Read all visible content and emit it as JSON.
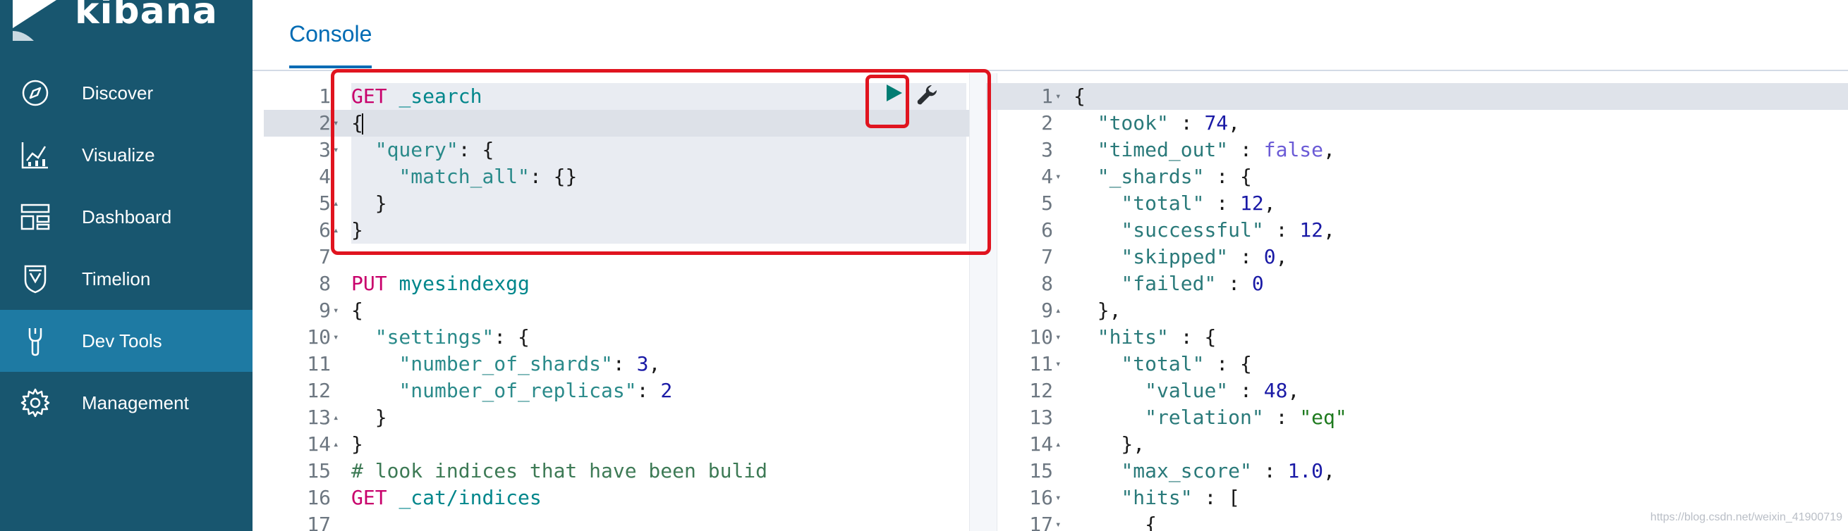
{
  "app": {
    "name": "kibana"
  },
  "sidebar": {
    "items": [
      {
        "label": "Discover",
        "icon": "compass-icon",
        "active": false
      },
      {
        "label": "Visualize",
        "icon": "chart-icon",
        "active": false
      },
      {
        "label": "Dashboard",
        "icon": "dashboard-icon",
        "active": false
      },
      {
        "label": "Timelion",
        "icon": "shield-icon",
        "active": false
      },
      {
        "label": "Dev Tools",
        "icon": "wrench-icon",
        "active": true
      },
      {
        "label": "Management",
        "icon": "gear-icon",
        "active": false
      }
    ]
  },
  "tabs": [
    {
      "label": "Console",
      "active": true
    }
  ],
  "request_editor": {
    "lines": [
      {
        "n": "1",
        "fold": "",
        "tokens": [
          [
            "kw",
            "GET"
          ],
          [
            "pun",
            " "
          ],
          [
            "url",
            "_search"
          ]
        ]
      },
      {
        "n": "2",
        "fold": "▾",
        "tokens": [
          [
            "pun",
            "{"
          ]
        ]
      },
      {
        "n": "3",
        "fold": "▾",
        "tokens": [
          [
            "pun",
            "  "
          ],
          [
            "key",
            "\"query\""
          ],
          [
            "pun",
            ": {"
          ]
        ]
      },
      {
        "n": "4",
        "fold": "",
        "tokens": [
          [
            "pun",
            "    "
          ],
          [
            "key",
            "\"match_all\""
          ],
          [
            "pun",
            ": {}"
          ]
        ]
      },
      {
        "n": "5",
        "fold": "▴",
        "tokens": [
          [
            "pun",
            "  }"
          ]
        ]
      },
      {
        "n": "6",
        "fold": "▴",
        "tokens": [
          [
            "pun",
            "}"
          ]
        ]
      },
      {
        "n": "7",
        "fold": "",
        "tokens": []
      },
      {
        "n": "8",
        "fold": "",
        "tokens": [
          [
            "kw",
            "PUT"
          ],
          [
            "pun",
            " "
          ],
          [
            "url",
            "myesindexgg"
          ]
        ]
      },
      {
        "n": "9",
        "fold": "▾",
        "tokens": [
          [
            "pun",
            "{"
          ]
        ]
      },
      {
        "n": "10",
        "fold": "▾",
        "tokens": [
          [
            "pun",
            "  "
          ],
          [
            "key",
            "\"settings\""
          ],
          [
            "pun",
            ": {"
          ]
        ]
      },
      {
        "n": "11",
        "fold": "",
        "tokens": [
          [
            "pun",
            "    "
          ],
          [
            "key",
            "\"number_of_shards\""
          ],
          [
            "pun",
            ": "
          ],
          [
            "num",
            "3"
          ],
          [
            "pun",
            ","
          ]
        ]
      },
      {
        "n": "12",
        "fold": "",
        "tokens": [
          [
            "pun",
            "    "
          ],
          [
            "key",
            "\"number_of_replicas\""
          ],
          [
            "pun",
            ": "
          ],
          [
            "num",
            "2"
          ]
        ]
      },
      {
        "n": "13",
        "fold": "▴",
        "tokens": [
          [
            "pun",
            "  }"
          ]
        ]
      },
      {
        "n": "14",
        "fold": "▴",
        "tokens": [
          [
            "pun",
            "}"
          ]
        ]
      },
      {
        "n": "15",
        "fold": "",
        "tokens": [
          [
            "cmt",
            "# look indices that have been bulid"
          ]
        ]
      },
      {
        "n": "16",
        "fold": "",
        "tokens": [
          [
            "kw",
            "GET"
          ],
          [
            "pun",
            " "
          ],
          [
            "url",
            "_cat/indices"
          ]
        ]
      },
      {
        "n": "17",
        "fold": "",
        "tokens": []
      }
    ]
  },
  "response_editor": {
    "lines": [
      {
        "n": "1",
        "fold": "▾",
        "tokens": [
          [
            "pun",
            "{"
          ]
        ]
      },
      {
        "n": "2",
        "fold": "",
        "tokens": [
          [
            "pun",
            "  "
          ],
          [
            "rkey",
            "\"took\""
          ],
          [
            "pun",
            " : "
          ],
          [
            "num",
            "74"
          ],
          [
            "pun",
            ","
          ]
        ]
      },
      {
        "n": "3",
        "fold": "",
        "tokens": [
          [
            "pun",
            "  "
          ],
          [
            "rkey",
            "\"timed_out\""
          ],
          [
            "pun",
            " : "
          ],
          [
            "bool",
            "false"
          ],
          [
            "pun",
            ","
          ]
        ]
      },
      {
        "n": "4",
        "fold": "▾",
        "tokens": [
          [
            "pun",
            "  "
          ],
          [
            "rkey",
            "\"_shards\""
          ],
          [
            "pun",
            " : {"
          ]
        ]
      },
      {
        "n": "5",
        "fold": "",
        "tokens": [
          [
            "pun",
            "    "
          ],
          [
            "rkey",
            "\"total\""
          ],
          [
            "pun",
            " : "
          ],
          [
            "num",
            "12"
          ],
          [
            "pun",
            ","
          ]
        ]
      },
      {
        "n": "6",
        "fold": "",
        "tokens": [
          [
            "pun",
            "    "
          ],
          [
            "rkey",
            "\"successful\""
          ],
          [
            "pun",
            " : "
          ],
          [
            "num",
            "12"
          ],
          [
            "pun",
            ","
          ]
        ]
      },
      {
        "n": "7",
        "fold": "",
        "tokens": [
          [
            "pun",
            "    "
          ],
          [
            "rkey",
            "\"skipped\""
          ],
          [
            "pun",
            " : "
          ],
          [
            "num",
            "0"
          ],
          [
            "pun",
            ","
          ]
        ]
      },
      {
        "n": "8",
        "fold": "",
        "tokens": [
          [
            "pun",
            "    "
          ],
          [
            "rkey",
            "\"failed\""
          ],
          [
            "pun",
            " : "
          ],
          [
            "num",
            "0"
          ]
        ]
      },
      {
        "n": "9",
        "fold": "▴",
        "tokens": [
          [
            "pun",
            "  },"
          ]
        ]
      },
      {
        "n": "10",
        "fold": "▾",
        "tokens": [
          [
            "pun",
            "  "
          ],
          [
            "rkey",
            "\"hits\""
          ],
          [
            "pun",
            " : {"
          ]
        ]
      },
      {
        "n": "11",
        "fold": "▾",
        "tokens": [
          [
            "pun",
            "    "
          ],
          [
            "rkey",
            "\"total\""
          ],
          [
            "pun",
            " : {"
          ]
        ]
      },
      {
        "n": "12",
        "fold": "",
        "tokens": [
          [
            "pun",
            "      "
          ],
          [
            "rkey",
            "\"value\""
          ],
          [
            "pun",
            " : "
          ],
          [
            "num",
            "48"
          ],
          [
            "pun",
            ","
          ]
        ]
      },
      {
        "n": "13",
        "fold": "",
        "tokens": [
          [
            "pun",
            "      "
          ],
          [
            "rkey",
            "\"relation\""
          ],
          [
            "pun",
            " : "
          ],
          [
            "str",
            "\"eq\""
          ]
        ]
      },
      {
        "n": "14",
        "fold": "▴",
        "tokens": [
          [
            "pun",
            "    },"
          ]
        ]
      },
      {
        "n": "15",
        "fold": "",
        "tokens": [
          [
            "pun",
            "    "
          ],
          [
            "rkey",
            "\"max_score\""
          ],
          [
            "pun",
            " : "
          ],
          [
            "num",
            "1.0"
          ],
          [
            "pun",
            ","
          ]
        ]
      },
      {
        "n": "16",
        "fold": "▾",
        "tokens": [
          [
            "pun",
            "    "
          ],
          [
            "rkey",
            "\"hits\""
          ],
          [
            "pun",
            " : ["
          ]
        ]
      },
      {
        "n": "17",
        "fold": "▾",
        "tokens": [
          [
            "pun",
            "      {"
          ]
        ]
      }
    ]
  },
  "watermark": "https://blog.csdn.net/weixin_41900719",
  "colors": {
    "sidebar": "#18566f",
    "sidebar_active": "#1e7aa3",
    "accent": "#006bb4",
    "annotation": "#e0141f"
  }
}
